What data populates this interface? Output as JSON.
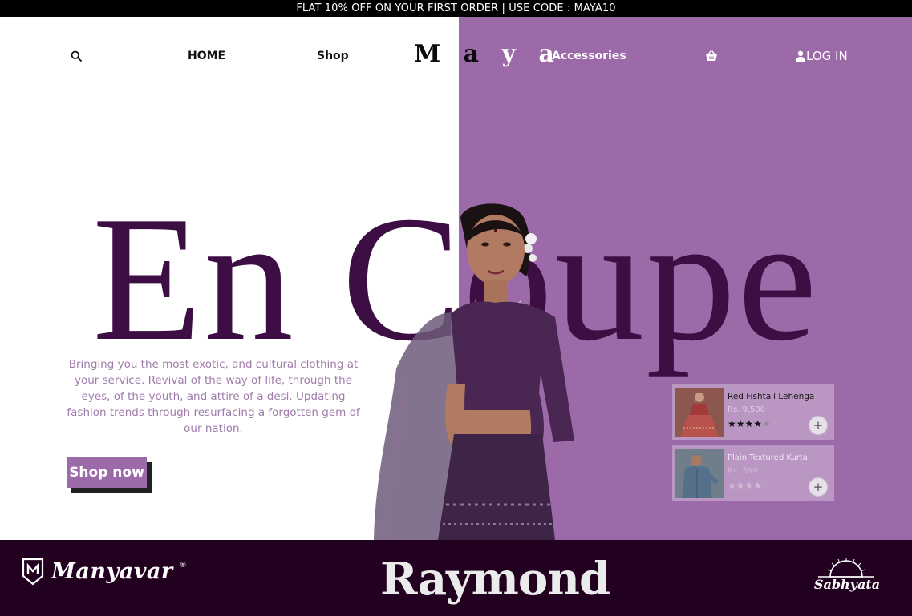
{
  "promo": {
    "text": "FLAT 10% OFF ON YOUR FIRST ORDER | USE CODE : MAYA10"
  },
  "nav": {
    "home": "HOME",
    "shop": "Shop",
    "accessories": "Accessories",
    "login": "LOG IN",
    "logo_left": "M a",
    "logo_right": "y a"
  },
  "icons": {
    "search": "search-icon",
    "cart": "basket-icon",
    "user": "user-icon"
  },
  "hero": {
    "headline": "En Coupe",
    "blurb": "Bringing you the most exotic, and cultural clothing at your service. Revival of the way of life, through the eyes, of the youth, and attire of a desi. Updating fashion trends through resurfacing a forgotten gem of our nation.",
    "cta": "Shop now"
  },
  "products": [
    {
      "name": "Red Fishtail Lehenga",
      "price": "Rs. 9,500",
      "rating": 4,
      "max_rating": 5,
      "add": "+"
    },
    {
      "name": "Plain Textured Kurta",
      "price": "Rs. 599",
      "rating": 4,
      "max_rating": 5,
      "add": "+"
    }
  ],
  "brands": {
    "manyavar": "Manyavar",
    "manyavar_reg": "®",
    "raymond": "Raymond",
    "sabhyata": "Sabhyata"
  },
  "colors": {
    "accent": "#9c69a9",
    "headline": "#3d0e44",
    "footer": "#220020",
    "promo_bg": "#000000"
  }
}
